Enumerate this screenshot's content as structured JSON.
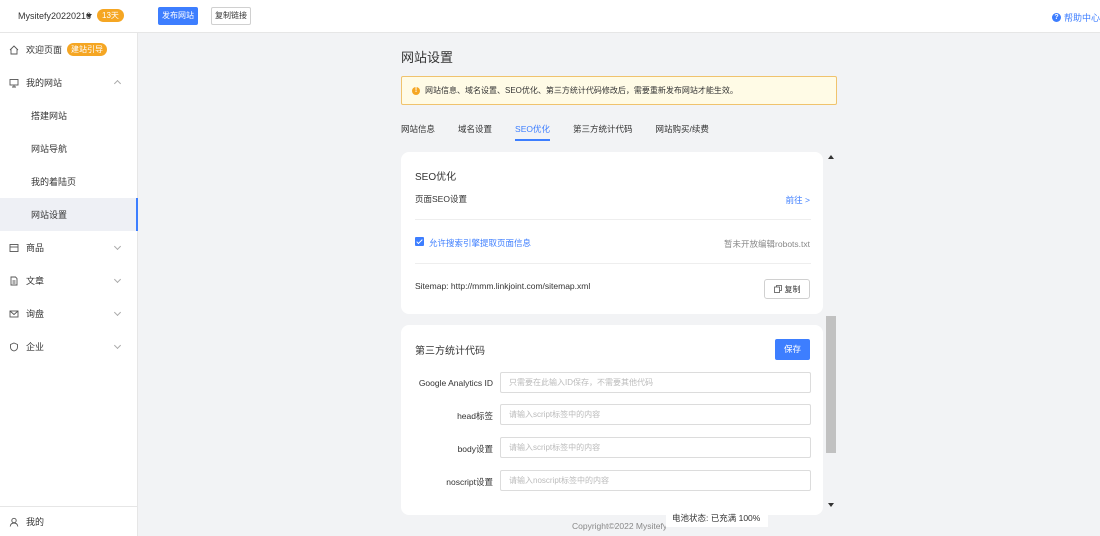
{
  "topbar": {
    "site_name": "Mysitefy20220216",
    "days_badge": "13天",
    "publish_label": "发布网站",
    "copy_link_label": "复制链接",
    "help_label": "帮助中心"
  },
  "sidebar": {
    "welcome": "欢迎页面",
    "guide_badge": "建站引导",
    "my_site": "我的网站",
    "sub_items": [
      "搭建网站",
      "网站导航",
      "我的着陆页",
      "网站设置"
    ],
    "products": "商品",
    "articles": "文章",
    "inquiry": "询盘",
    "company": "企业",
    "me": "我的"
  },
  "main": {
    "title": "网站设置",
    "notice": "网站信息、域名设置、SEO优化、第三方统计代码修改后，需要重新发布网站才能生效。",
    "tabs": [
      "网站信息",
      "域名设置",
      "SEO优化",
      "第三方统计代码",
      "网站购买/续费"
    ],
    "active_tab": "SEO优化"
  },
  "seo": {
    "title": "SEO优化",
    "page_seo": "页面SEO设置",
    "go_label": "前往 >",
    "allow_crawl": "允许搜索引擎提取页面信息",
    "robots_note": "暂未开放编辑robots.txt",
    "sitemap": "Sitemap: http://mmm.linkjoint.com/sitemap.xml",
    "copy_label": "复制"
  },
  "third_party": {
    "title": "第三方统计代码",
    "save_label": "保存",
    "fields": [
      {
        "label": "Google Analytics ID",
        "placeholder": "只需要在此输入ID保存，不需要其他代码"
      },
      {
        "label": "head标签",
        "placeholder": "请输入script标签中的内容"
      },
      {
        "label": "body设置",
        "placeholder": "请输入script标签中的内容"
      },
      {
        "label": "noscript设置",
        "placeholder": "请输入noscript标签中的内容"
      }
    ]
  },
  "footer": {
    "copyright": "Copyright©2022 Mysitefy",
    "battery": "电池状态: 已充满 100%"
  },
  "colors": {
    "accent": "#3d7eff",
    "badge": "#f5a623"
  }
}
